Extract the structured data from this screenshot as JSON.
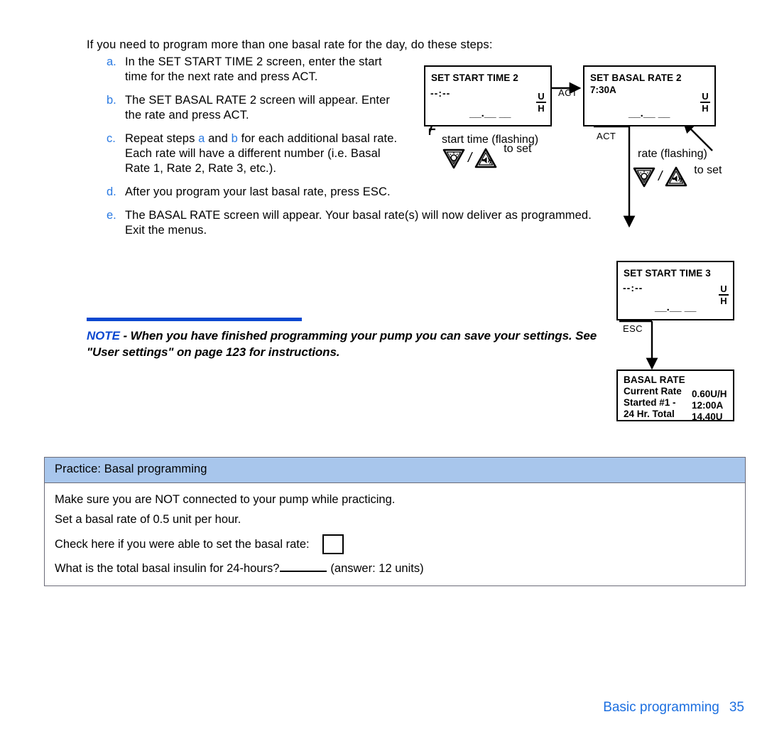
{
  "intro": {
    "text": "If you need to program more than one basal rate for the day, do these steps:"
  },
  "steps": [
    {
      "marker": "a.",
      "text": "In the SET START TIME 2 screen, enter the start time for the next rate and press ACT."
    },
    {
      "marker": "b.",
      "text": "The SET BASAL RATE 2 screen will appear. Enter the rate and press ACT."
    },
    {
      "marker": "c.",
      "text_part1": "Repeat steps ",
      "ref_a": "a",
      "text_part2": " and ",
      "ref_b": "b",
      "text_part3": " for each additional basal rate. Each rate will have a different number (i.e. Basal Rate 1, Rate 2, Rate 3, etc.)."
    },
    {
      "marker": "d.",
      "text": "After you program your last basal rate, press ESC."
    },
    {
      "marker": "e.",
      "text": "The BASAL RATE screen will appear. Your basal rate(s) will now deliver as programmed. Exit the menus."
    }
  ],
  "note": {
    "label": "NOTE",
    "dash": " - ",
    "text": "When you have finished programming your pump you can save your settings. See \"User settings\" on page 123 for instructions.",
    "rule_color": "#0b48d0",
    "label_color": "#0b48d0"
  },
  "diagram": {
    "screens": {
      "set_start_time_2": {
        "title": "SET START TIME 2",
        "time": "--:--",
        "units_top": "U",
        "units_bottom": "H",
        "blanks": "__.__ __"
      },
      "set_basal_rate_2": {
        "title": "SET BASAL RATE 2",
        "time": "7:30A",
        "units_top": "U",
        "units_bottom": "H",
        "blanks": "__.__ __"
      },
      "set_start_time_3": {
        "title": "SET START TIME 3",
        "time": "--:--",
        "units_top": "U",
        "units_bottom": "H",
        "blanks": "__.__ __"
      },
      "basal_rate": {
        "title": "BASAL RATE",
        "rows": [
          {
            "label": "Current Rate",
            "value": "0.60U/H"
          },
          {
            "label": "Started #1 -",
            "value": "12:00A"
          },
          {
            "label": "24 Hr. Total",
            "value": "14.40U"
          }
        ]
      }
    },
    "edges": {
      "act_horizontal": "ACT",
      "act_vertical": "ACT",
      "esc": "ESC"
    },
    "callouts": {
      "start_time_flashing": "start time (flashing)",
      "to_set_1": "to set",
      "rate_flashing": "rate (flashing)",
      "to_set_2": "to set",
      "separator": "/"
    },
    "buttons": {
      "down_icon": "down-triangle-light-button-icon",
      "up_icon": "up-triangle-sound-button-icon"
    }
  },
  "practice": {
    "header": "Practice: Basal programming",
    "line1": "Make sure you are NOT connected to your pump while practicing.",
    "line2": "Set a basal rate of 0.5 unit per hour.",
    "check_label": "Check here if you were able to set the basal rate:",
    "total_question": "What is the total basal insulin for 24-hours?",
    "answer": "(answer: 12 units)",
    "header_color": "#a8c6ec"
  },
  "footer": {
    "section": "Basic programming",
    "page": "35",
    "color": "#1c6fe0"
  }
}
